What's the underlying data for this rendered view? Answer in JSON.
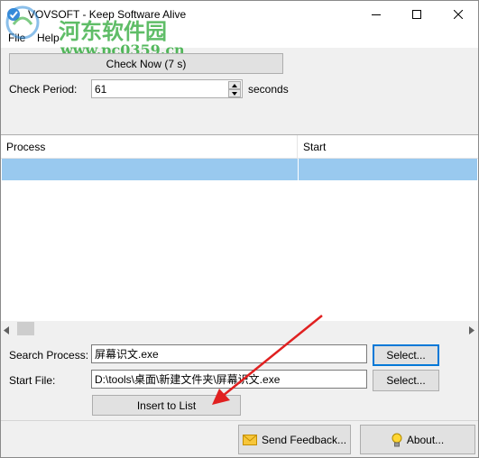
{
  "window": {
    "title": "VOVSOFT - Keep Software Alive"
  },
  "menu": [
    "File",
    "Help"
  ],
  "check_now_label": "Check Now (7 s)",
  "check_period": {
    "label": "Check Period:",
    "value": "61",
    "unit": "seconds"
  },
  "table": {
    "columns": [
      "Process",
      "Start"
    ],
    "rows": [
      [
        "",
        ""
      ]
    ]
  },
  "search_process": {
    "label": "Search Process:",
    "value": "屏幕识文.exe",
    "button": "Select..."
  },
  "start_file": {
    "label": "Start File:",
    "value": "D:\\tools\\桌面\\新建文件夹\\屏幕识文.exe",
    "button": "Select..."
  },
  "insert_label": "Insert to List",
  "footer": {
    "feedback_label": "Send Feedback...",
    "about_label": "About..."
  },
  "watermark": {
    "name": "河东软件园",
    "url": "www.pc0359.cn"
  },
  "colors": {
    "selection": "#99c9ef",
    "focus_border": "#0078d7",
    "annotation_arrow": "#e02020",
    "watermark": "#2aa835"
  },
  "icons": [
    "app-icon",
    "minimize-icon",
    "maximize-icon",
    "close-icon",
    "spin-up-icon",
    "spin-down-icon",
    "scroll-left-icon",
    "scroll-right-icon",
    "envelope-icon",
    "lightbulb-icon",
    "red-arrow-icon"
  ]
}
